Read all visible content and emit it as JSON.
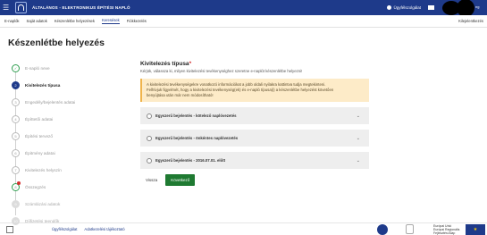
{
  "topbar": {
    "menu_icon": "☰",
    "app_title": "ÁLTALÁNOS - ELEKTRONIKUS ÉPÍTÉSI NAPLÓ",
    "help_label": "Ügyfélszolgálat",
    "user_initials": "ng"
  },
  "nav": {
    "items": [
      "E-naplók",
      "Saját adatok",
      "Készenlétbe helyezések",
      "Keresések",
      "Fiókkezelés"
    ],
    "active_index": 3,
    "right_link": "Kilejelentkezés"
  },
  "page": {
    "title": "Készenlétbe helyezés"
  },
  "steps": [
    {
      "label": "E-napló neve",
      "state": "done",
      "marker": "✓"
    },
    {
      "label": "Kivitelezés típusa",
      "state": "current",
      "marker": "2"
    },
    {
      "label": "Engedély/bejelentés adatai",
      "state": "todo",
      "marker": "3"
    },
    {
      "label": "Építtetői adatai",
      "state": "todo",
      "marker": "4"
    },
    {
      "label": "Építési tervező",
      "state": "todo",
      "marker": "5"
    },
    {
      "label": "Épitmény adatai",
      "state": "todo",
      "marker": "6"
    },
    {
      "label": "Kivitelezés helyszín",
      "state": "todo",
      "marker": "7"
    },
    {
      "label": "Összegzés",
      "state": "error",
      "marker": "8"
    },
    {
      "label": "Számlázási adatok",
      "state": "disabled",
      "marker": "9"
    },
    {
      "label": "Díjfizetési teendők",
      "state": "disabled",
      "marker": "10"
    }
  ],
  "main": {
    "heading": "Kivitelezés típusa",
    "required_mark": "*",
    "description": "Kérjük, válassza ki, milyen kivitelezési tevékenységhez szeretne e-naplót készenlétbe helyezni!",
    "notice_lines": [
      "A kivitelezési tevékenységekre vonatkozó információkat a jobb oldali nyilakra kattintva tudja megtekinteni.",
      "Felhívjuk figyelmét, hogy a kivitelezési tevékenység(ek) és e-napló típusa(i) a készenlétbe helyezést követően",
      "benyújtása után már nem módosítható!"
    ],
    "options": [
      {
        "label": "Egyszerű bejelentés - kötelező naplóvezetés"
      },
      {
        "label": "Egyszerű bejelentés - önkéntes naplóvezetés"
      },
      {
        "label": "Egyszerű bejelentés - 2016.07.01. előtt"
      }
    ],
    "chevron_icon": "⌄",
    "back_label": "Vissza",
    "next_label": "Következő"
  },
  "footer": {
    "links": [
      "Ügyfélszolgálat",
      "Adatkezelési tájékoztató"
    ],
    "eu_text": [
      "Európai Unió",
      "Európai Regionális",
      "Fejlesztési Alap"
    ],
    "eu_flag_glyph": "★"
  }
}
